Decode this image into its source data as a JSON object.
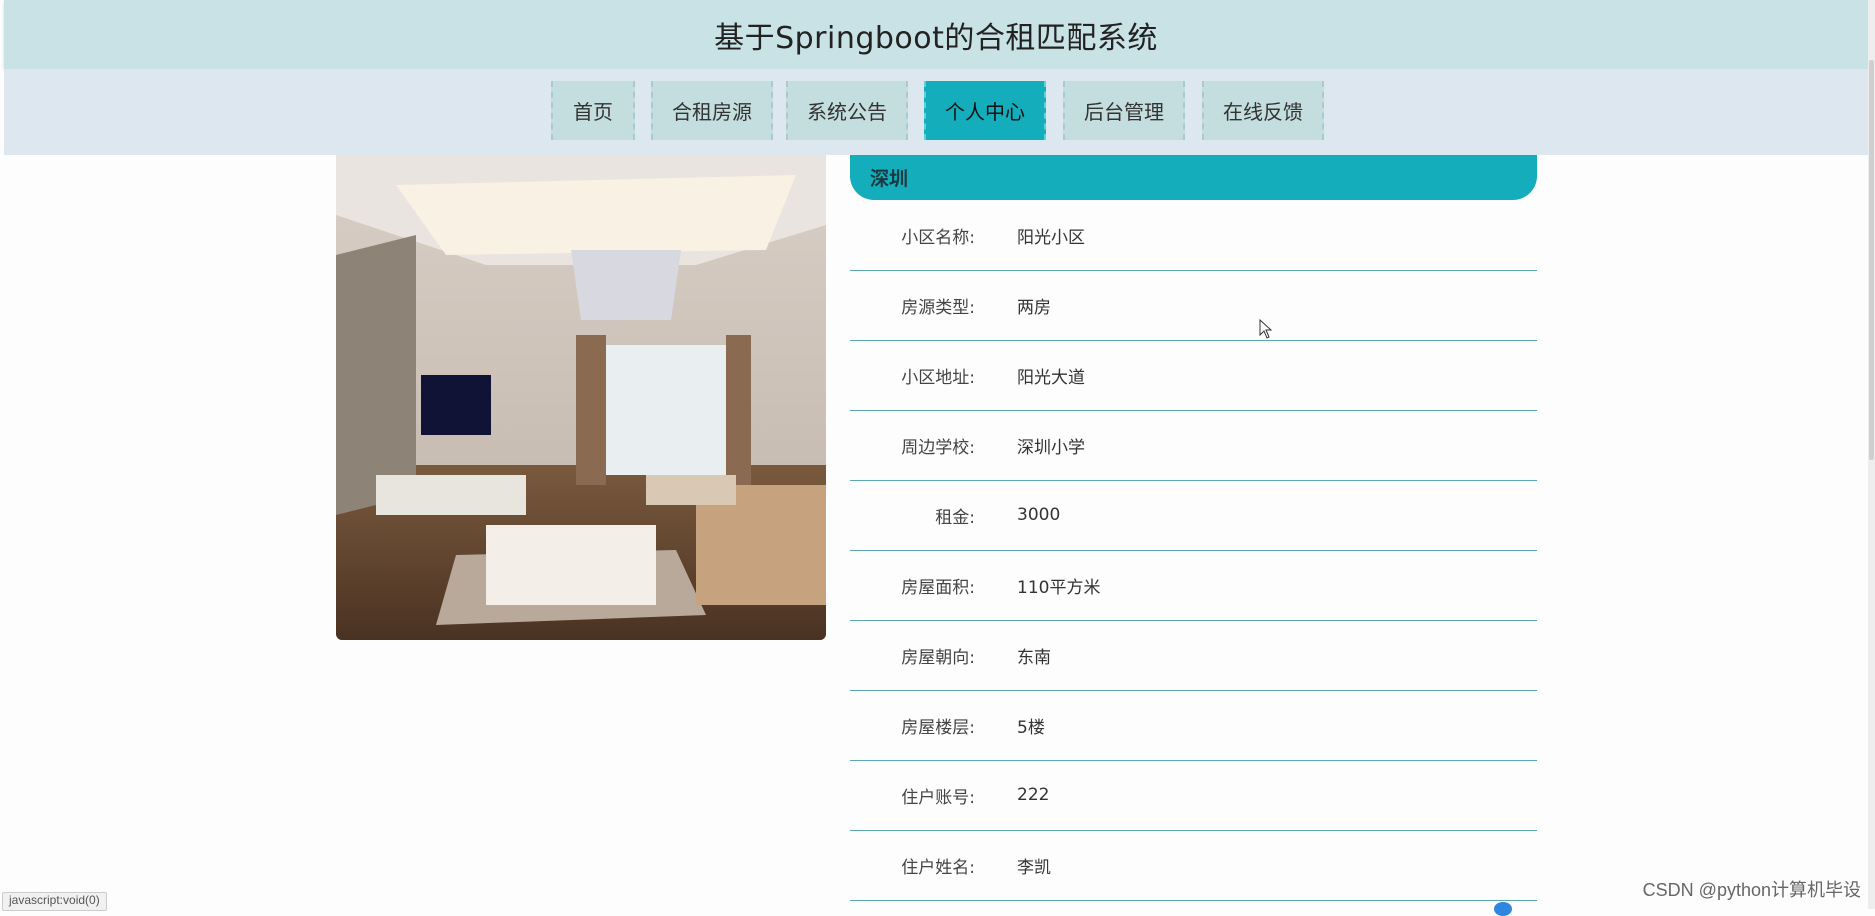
{
  "header": {
    "title": "基于Springboot的合租匹配系统"
  },
  "nav": {
    "items": [
      {
        "label": "首页"
      },
      {
        "label": "合租房源"
      },
      {
        "label": "系统公告"
      },
      {
        "label": "个人中心"
      },
      {
        "label": "后台管理"
      },
      {
        "label": "在线反馈"
      }
    ],
    "active": "个人中心"
  },
  "detail": {
    "city": "深圳",
    "rows": [
      {
        "label": "小区名称:",
        "value": "阳光小区"
      },
      {
        "label": "房源类型:",
        "value": "两房"
      },
      {
        "label": "小区地址:",
        "value": "阳光大道"
      },
      {
        "label": "周边学校:",
        "value": "深圳小学"
      },
      {
        "label": "租金:",
        "value": "3000"
      },
      {
        "label": "房屋面积:",
        "value": "110平方米"
      },
      {
        "label": "房屋朝向:",
        "value": "东南"
      },
      {
        "label": "房屋楼层:",
        "value": "5楼"
      },
      {
        "label": "住户账号:",
        "value": "222"
      },
      {
        "label": "住户姓名:",
        "value": "李凯"
      }
    ]
  },
  "status_bar": {
    "text": "javascript:void(0)"
  },
  "watermark": {
    "text": "CSDN @python计算机毕设"
  },
  "colors": {
    "accent": "#13adbb",
    "header_bg": "#c9e2e5",
    "nav_bg": "#dde7ef",
    "nav_item_bg": "#c4ddde",
    "row_border": "#5ba7b8"
  }
}
